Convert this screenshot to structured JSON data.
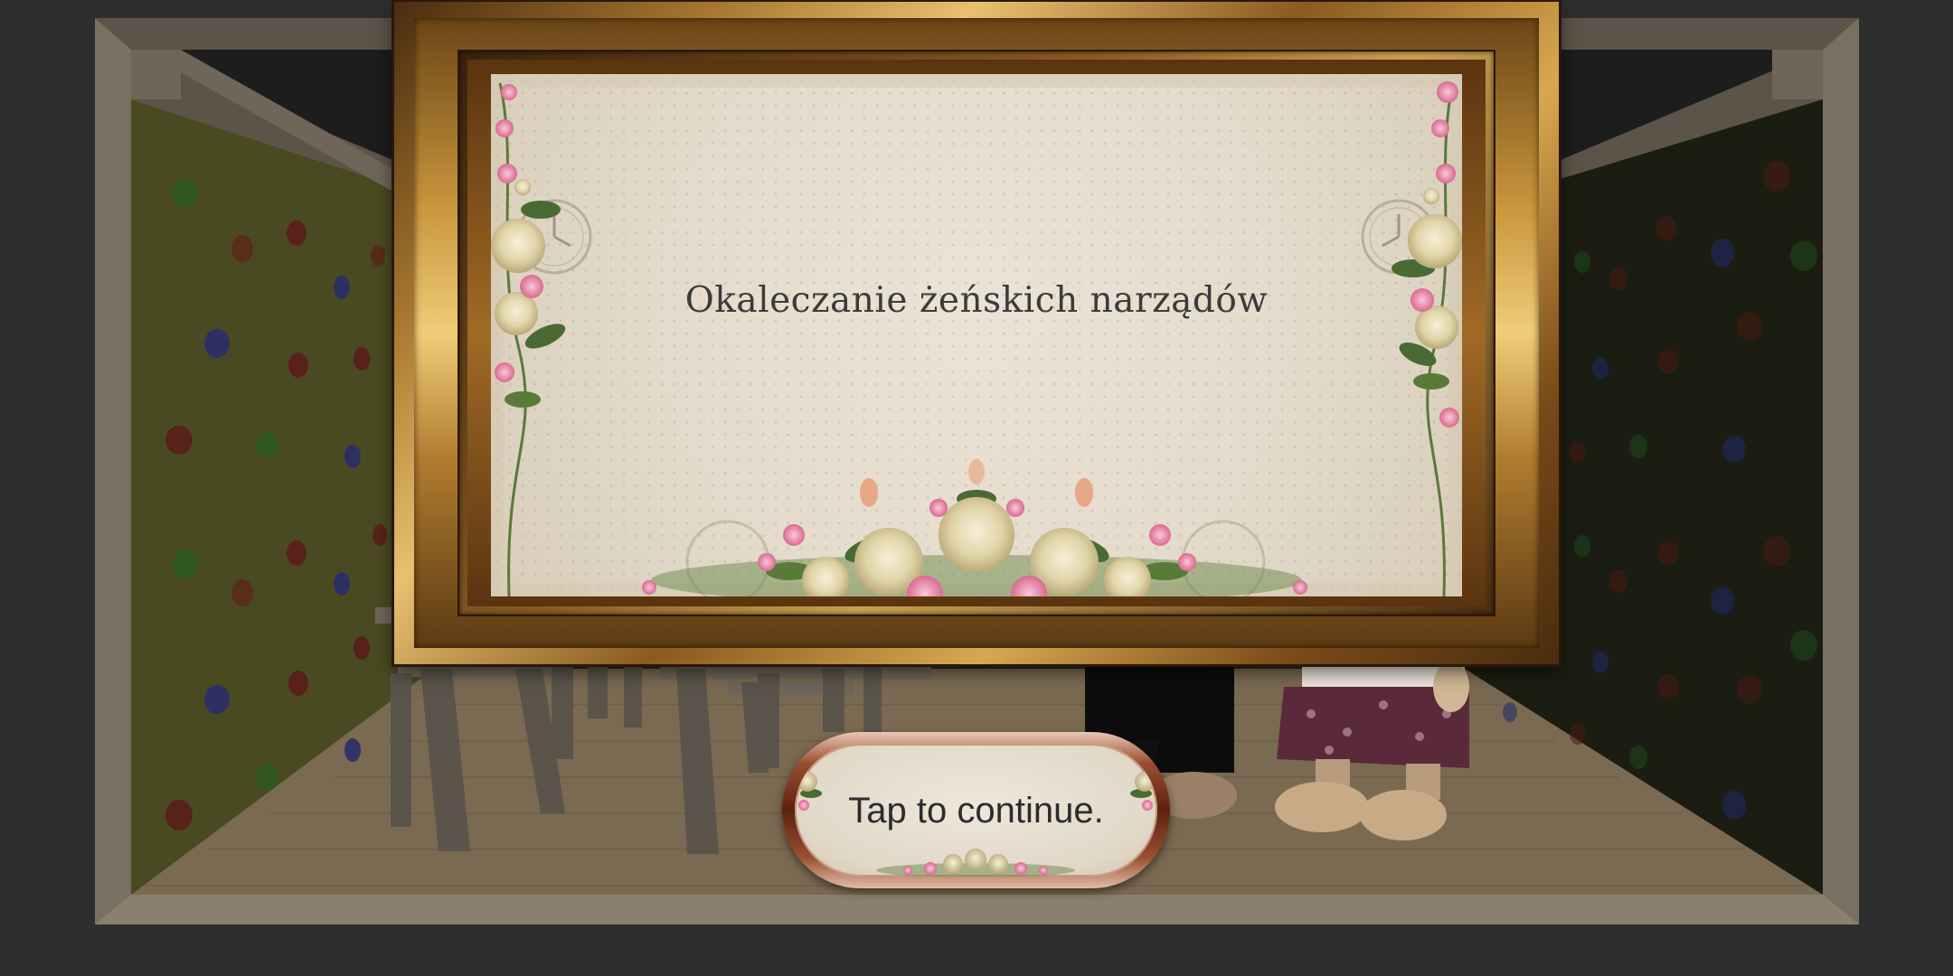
{
  "dialog": {
    "title": "Okaleczanie żeńskich narządów"
  },
  "continue_button": {
    "label": "Tap to continue."
  },
  "colors": {
    "left_wall": "#4a4a22",
    "right_wall": "#1b1d12",
    "floor": "#7b6a52",
    "room_trim": "#6f6659",
    "frame_gold": "#c8963c",
    "button_rim": "#5c2210",
    "title_text": "#3b3b3b"
  },
  "icons": {
    "floral_decor": "rose-bouquet-icon",
    "clock_decor": "clock-icon"
  }
}
